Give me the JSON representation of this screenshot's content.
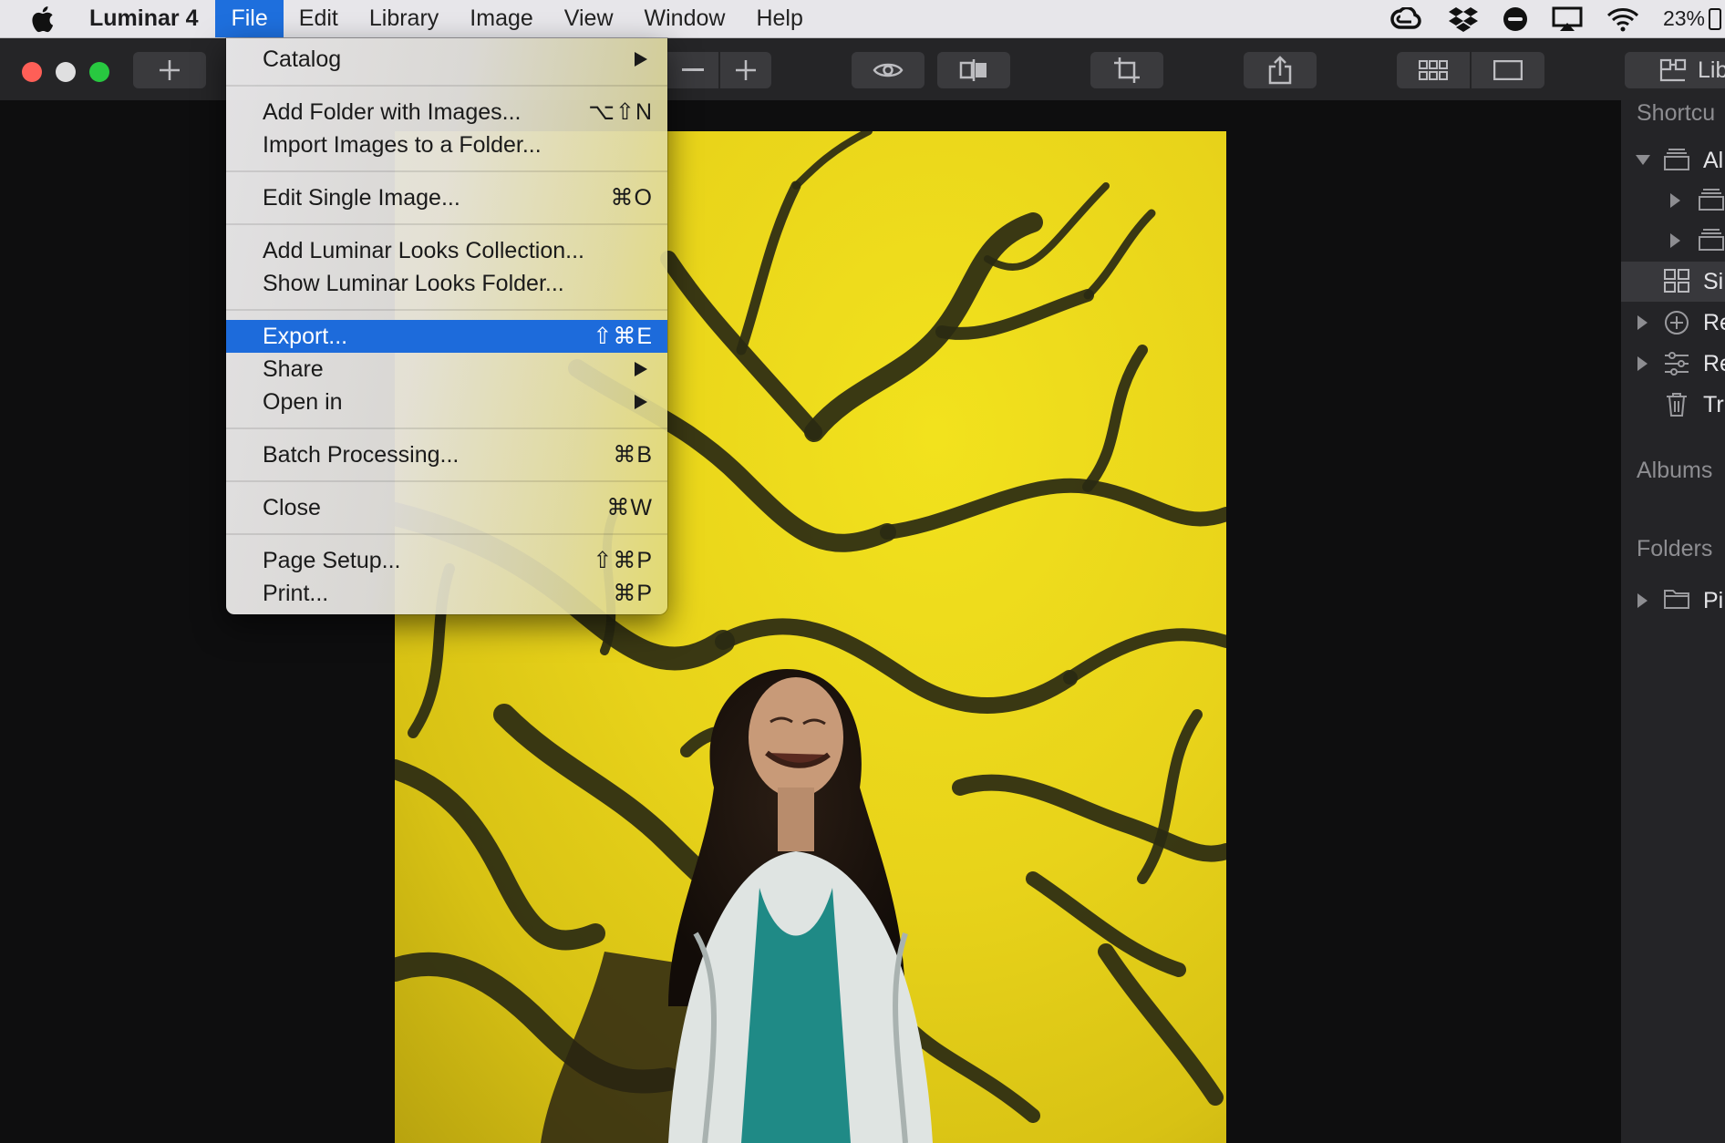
{
  "menubar": {
    "app_name": "Luminar 4",
    "menus": [
      "File",
      "Edit",
      "Library",
      "Image",
      "View",
      "Window",
      "Help"
    ],
    "active_menu": "File",
    "status": {
      "battery_percent": "23%"
    },
    "icons": [
      "apple-icon",
      "creative-cloud-icon",
      "dropbox-icon",
      "do-not-disturb-icon",
      "airplay-icon",
      "wifi-icon",
      "battery-icon"
    ]
  },
  "toolbar": {
    "library_label": "Lib",
    "icons": [
      "add-icon",
      "zoom-out-icon",
      "zoom-in-icon",
      "eye-preview-icon",
      "compare-icon",
      "crop-icon",
      "share-icon",
      "grid-view-icon",
      "single-view-icon",
      "library-panel-icon"
    ]
  },
  "file_menu": {
    "items": [
      {
        "label": "Catalog",
        "shortcut": "",
        "submenu": true
      },
      {
        "label": "Add Folder with Images...",
        "shortcut": "⌥⇧N"
      },
      {
        "label": "Import Images to a Folder...",
        "shortcut": ""
      },
      {
        "label": "Edit Single Image...",
        "shortcut": "⌘O"
      },
      {
        "label": "Add Luminar Looks Collection...",
        "shortcut": ""
      },
      {
        "label": "Show Luminar Looks Folder...",
        "shortcut": ""
      },
      {
        "label": "Export...",
        "shortcut": "⇧⌘E",
        "highlighted": true
      },
      {
        "label": "Share",
        "shortcut": "",
        "submenu": true
      },
      {
        "label": "Open in",
        "shortcut": "",
        "submenu": true
      },
      {
        "label": "Batch Processing...",
        "shortcut": "⌘B"
      },
      {
        "label": "Close",
        "shortcut": "⌘W"
      },
      {
        "label": "Page Setup...",
        "shortcut": "⇧⌘P"
      },
      {
        "label": "Print...",
        "shortcut": "⌘P"
      }
    ]
  },
  "sidebar": {
    "shortcuts_heading": "Shortcu",
    "rows": [
      {
        "label": "Al",
        "icon": "all-photos-icon"
      },
      {
        "label": "",
        "icon": "collection-icon"
      },
      {
        "label": "",
        "icon": "collection-icon"
      },
      {
        "label": "Si",
        "icon": "single-image-edits-icon",
        "selected": true
      },
      {
        "label": "Re",
        "icon": "recently-added-icon"
      },
      {
        "label": "Re",
        "icon": "recently-edited-icon"
      },
      {
        "label": "Tr",
        "icon": "trash-icon"
      }
    ],
    "albums_heading": "Albums",
    "folders_heading": "Folders",
    "folders": [
      {
        "label": "Pi",
        "icon": "folder-icon"
      }
    ]
  },
  "colors": {
    "menu_highlight": "#1d6bdb",
    "photo_yellow": "#e8d31a",
    "toolbar_bg": "#252527",
    "sidebar_bg": "#242427"
  }
}
